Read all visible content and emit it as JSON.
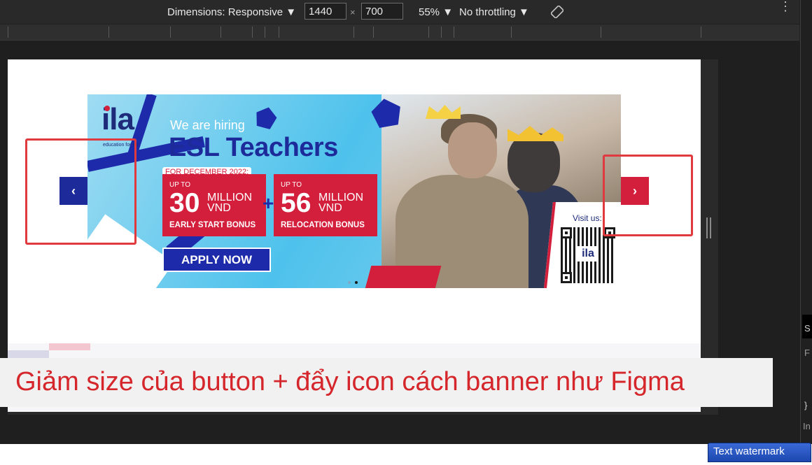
{
  "devtools": {
    "dimensions_label": "Dimensions: Responsive ▼",
    "width_value": "1440",
    "times_symbol": "×",
    "height_value": "700",
    "zoom_label": "55% ▼",
    "throttle_label": "No throttling ▼",
    "more_icon": "⋮",
    "side_chars": [
      "S",
      "F",
      "}",
      "In"
    ]
  },
  "banner": {
    "logo_text": "ila",
    "logo_tagline": "education for life",
    "hiring_text": "We are hiring",
    "headline": "ESL Teachers",
    "promo_label": "FOR DECEMBER 2022:",
    "bonuses": [
      {
        "up_to": "UP TO",
        "amount": "30",
        "unit_top": "MILLION",
        "unit_bottom": "VND",
        "label": "EARLY START BONUS"
      },
      {
        "up_to": "UP TO",
        "amount": "56",
        "unit_top": "MILLION",
        "unit_bottom": "VND",
        "label": "RELOCATION BONUS"
      }
    ],
    "plus_sign": "+",
    "cta": "APPLY NOW",
    "visit_text": "Visit us:",
    "qr_logo": "ila",
    "active_slide": 2,
    "slide_count": 2
  },
  "carousel": {
    "prev_icon": "‹",
    "next_icon": "›"
  },
  "annotation": {
    "caption": "Giảm size của button + đẩy icon cách banner như Figma",
    "color": "#e0393e"
  },
  "watermark": {
    "text": "Text watermark"
  },
  "colors": {
    "brand_blue": "#1d2b9a",
    "brand_red": "#d31f3b",
    "banner_sky": "#4ec2ec"
  }
}
